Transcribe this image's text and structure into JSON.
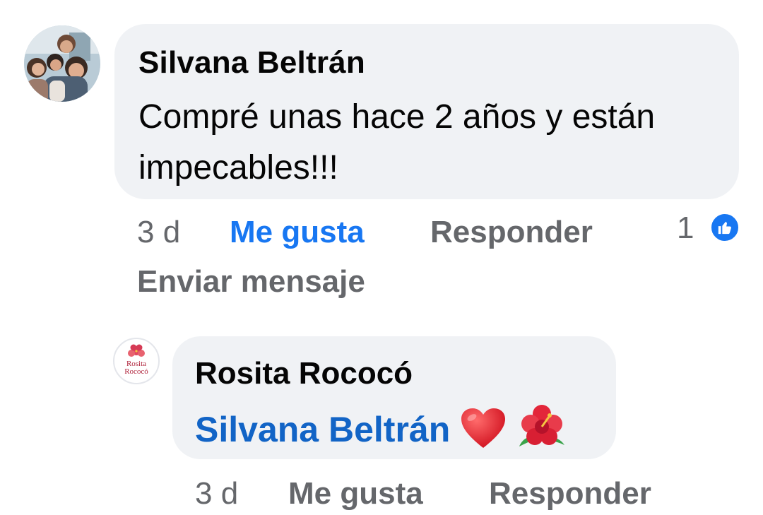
{
  "comment": {
    "author": "Silvana Beltrán",
    "text": "Compré unas hace 2 años y están impecables!!!",
    "time": "3 d",
    "like_label": "Me gusta",
    "reply_label": "Responder",
    "message_label": "Enviar mensaje",
    "reaction_count": "1",
    "reaction_icon": "like-icon",
    "liked": true
  },
  "reply": {
    "author": "Rosita Rococó",
    "mention": "Silvana Beltrán",
    "emojis": [
      "red-heart",
      "hibiscus"
    ],
    "avatar_logo": [
      "Rosita",
      "Rococó"
    ],
    "time": "3 d",
    "like_label": "Me gusta",
    "reply_label": "Responder"
  },
  "colors": {
    "accent": "#1877f2",
    "mention": "#1264c6",
    "bubble": "#f0f2f5",
    "secondary_text": "#65676b",
    "primary_text": "#050505"
  }
}
